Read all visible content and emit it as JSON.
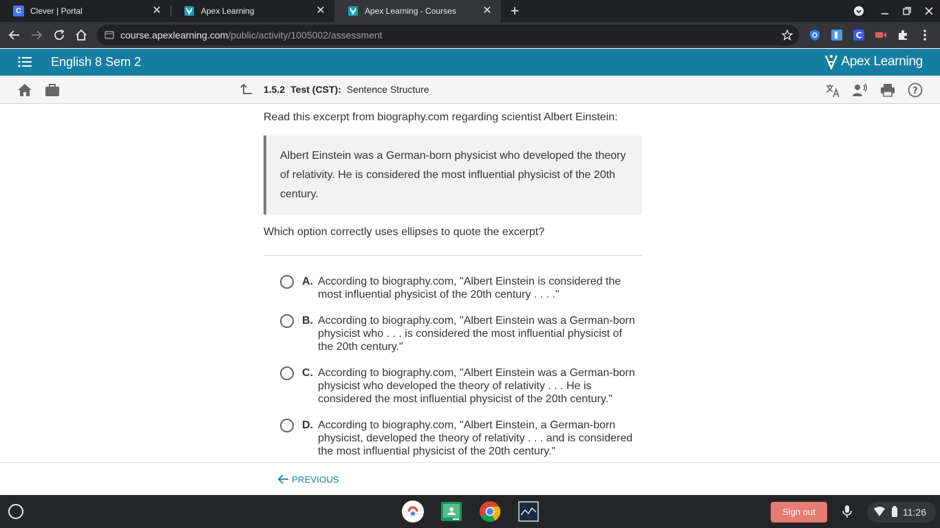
{
  "browser": {
    "tabs": [
      {
        "title": "Clever | Portal",
        "favicon": "clever-icon"
      },
      {
        "title": "Apex Learning",
        "favicon": "apex-icon"
      },
      {
        "title": "Apex Learning - Courses",
        "favicon": "apex-icon"
      }
    ],
    "url": {
      "host": "course.apexlearning.com",
      "path": "/public/activity/1005002/assessment"
    }
  },
  "apex": {
    "course_title": "English 8 Sem 2",
    "logo_text": "Apex Learning",
    "brand_color": "#167ea0"
  },
  "toolbar": {
    "activity_number": "1.5.2",
    "activity_type": "Test (CST):",
    "activity_title": "Sentence Structure"
  },
  "question": {
    "intro": "Read this excerpt from biography.com regarding scientist Albert Einstein:",
    "excerpt": "Albert Einstein was a German-born physicist who developed the theory of relativity. He is considered the most influential physicist of the 20th century.",
    "prompt": "Which option correctly uses ellipses to quote the excerpt?",
    "options": [
      {
        "letter": "A.",
        "text": "According to biography.com, \"Albert Einstein is considered the most influential physicist of the 20th century . . . .\""
      },
      {
        "letter": "B.",
        "text": "According to biography.com, \"Albert Einstein was a German-born physicist who . . . is considered the most influential physicist of the 20th century.\""
      },
      {
        "letter": "C.",
        "text": "According to biography.com, \"Albert Einstein was a German-born physicist who developed the theory of relativity . . . He is considered the most influential physicist of the 20th century.\""
      },
      {
        "letter": "D.",
        "text": "According to biography.com, \"Albert Einstein, a German-born physicist, developed the theory of relativity . . . and is considered the most influential physicist of the 20th century.\""
      }
    ]
  },
  "nav": {
    "previous_label": "PREVIOUS"
  },
  "shelf": {
    "sign_out": "Sign out",
    "time": "11:26"
  }
}
